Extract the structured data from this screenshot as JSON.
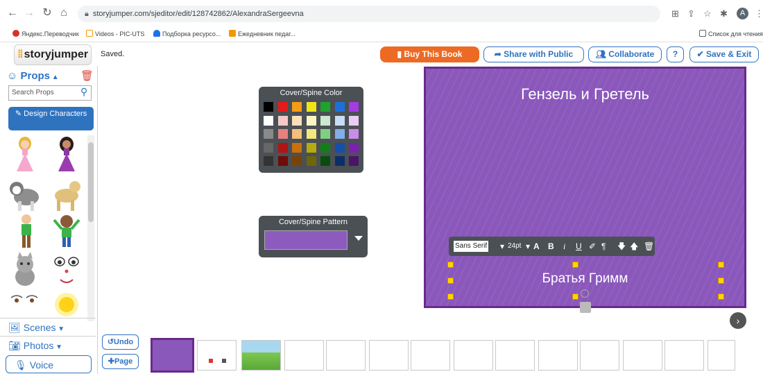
{
  "browser": {
    "url": "storyjumper.com/sjeditor/edit/128742862/AlexandraSergeevna",
    "avatar_letter": "A",
    "bookmarks": [
      {
        "label": "Яндекс.Переводчик",
        "color": "#d93025"
      },
      {
        "label": "Videos - PIC-UTS",
        "color": "#f29900"
      },
      {
        "label": "Подборка ресурсо...",
        "color": "#1a73e8"
      },
      {
        "label": "Ежедневник педаг...",
        "color": "#f29900"
      }
    ],
    "reading_list": "Список для чтения"
  },
  "app": {
    "logo_text": "storyjumper",
    "status": "Saved.",
    "buttons": {
      "buy": "Buy This Book",
      "share": "Share with Public",
      "collaborate": "Collaborate",
      "help": "?",
      "save_exit": "Save & Exit"
    }
  },
  "left_panel": {
    "props_label": "Props",
    "search_placeholder": "Search Props",
    "design_button": "Design Characters",
    "nav": {
      "scenes": "Scenes",
      "photos": "Photos",
      "voice": "Voice"
    }
  },
  "controls": {
    "undo": "Undo",
    "page": "Page"
  },
  "color_panel": {
    "title": "Cover/Spine Color",
    "colors": [
      [
        "#000000",
        "#e31b1b",
        "#f59b16",
        "#f0e418",
        "#1fa32a",
        "#1f6fd9",
        "#a53be0"
      ],
      [
        "#ffffff",
        "#f6c9c9",
        "#fde0b8",
        "#fbf6c5",
        "#cbe9cc",
        "#c8dcf6",
        "#e8cdf5"
      ],
      [
        "#8a8a8a",
        "#e88080",
        "#f5c07a",
        "#f1e77d",
        "#7fcf83",
        "#80aee9",
        "#c98ce8"
      ],
      [
        "#666666",
        "#b01414",
        "#c9700d",
        "#b5ab10",
        "#117e1a",
        "#154fa8",
        "#7b22ad"
      ],
      [
        "#333333",
        "#6e0b0b",
        "#7a4306",
        "#6e6707",
        "#084d0e",
        "#0b2f66",
        "#4a1369"
      ]
    ]
  },
  "pattern_panel": {
    "title": "Cover/Spine Pattern",
    "swatch_color": "#8d5bbd"
  },
  "cover": {
    "title": "Гензель и Гретель",
    "author": "Братья Гримм",
    "background": "#8a57bb"
  },
  "text_toolbar": {
    "font": "Sans Serif",
    "size": "24pt"
  },
  "thumbnails": {
    "count": 14
  }
}
